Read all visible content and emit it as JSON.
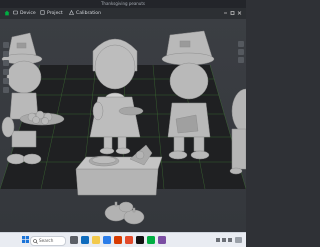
{
  "window": {
    "title": "Thanksgiving peanuts"
  },
  "tabs": [
    {
      "label": "Device"
    },
    {
      "label": "Project"
    },
    {
      "label": "Calibration"
    }
  ],
  "taskbar": {
    "search_placeholder": "Search"
  },
  "colors": {
    "model_gray": "#b9b9b9",
    "plate_dark": "#1f2022",
    "grid_green": "#4a8f3a",
    "accent_green": "#00ae42",
    "taskbar": "#e9ecf2"
  }
}
